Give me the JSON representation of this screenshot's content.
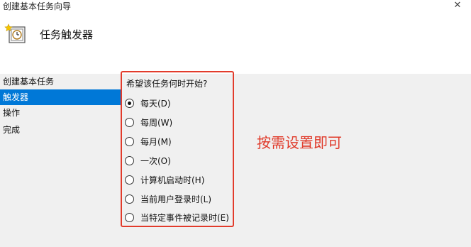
{
  "window": {
    "title": "创建基本任务向导",
    "close_symbol": "✕"
  },
  "header": {
    "icon": "task-clock-icon",
    "title": "任务触发器"
  },
  "nav": {
    "items": [
      {
        "label": "创建基本任务",
        "selected": false
      },
      {
        "label": "触发器",
        "selected": true
      },
      {
        "label": "操作",
        "selected": false
      },
      {
        "label": "完成",
        "selected": false
      }
    ]
  },
  "trigger": {
    "question": "希望该任务何时开始?",
    "options": [
      {
        "label": "每天(D)",
        "checked": true
      },
      {
        "label": "每周(W)",
        "checked": false
      },
      {
        "label": "每月(M)",
        "checked": false
      },
      {
        "label": "一次(O)",
        "checked": false
      },
      {
        "label": "计算机启动时(H)",
        "checked": false
      },
      {
        "label": "当前用户登录时(L)",
        "checked": false
      },
      {
        "label": "当特定事件被记录时(E)",
        "checked": false
      }
    ]
  },
  "annotation": {
    "text": "按需设置即可",
    "color": "#e03a2a"
  },
  "colors": {
    "selection": "#0078d7",
    "highlight_border": "#e23b2b"
  }
}
